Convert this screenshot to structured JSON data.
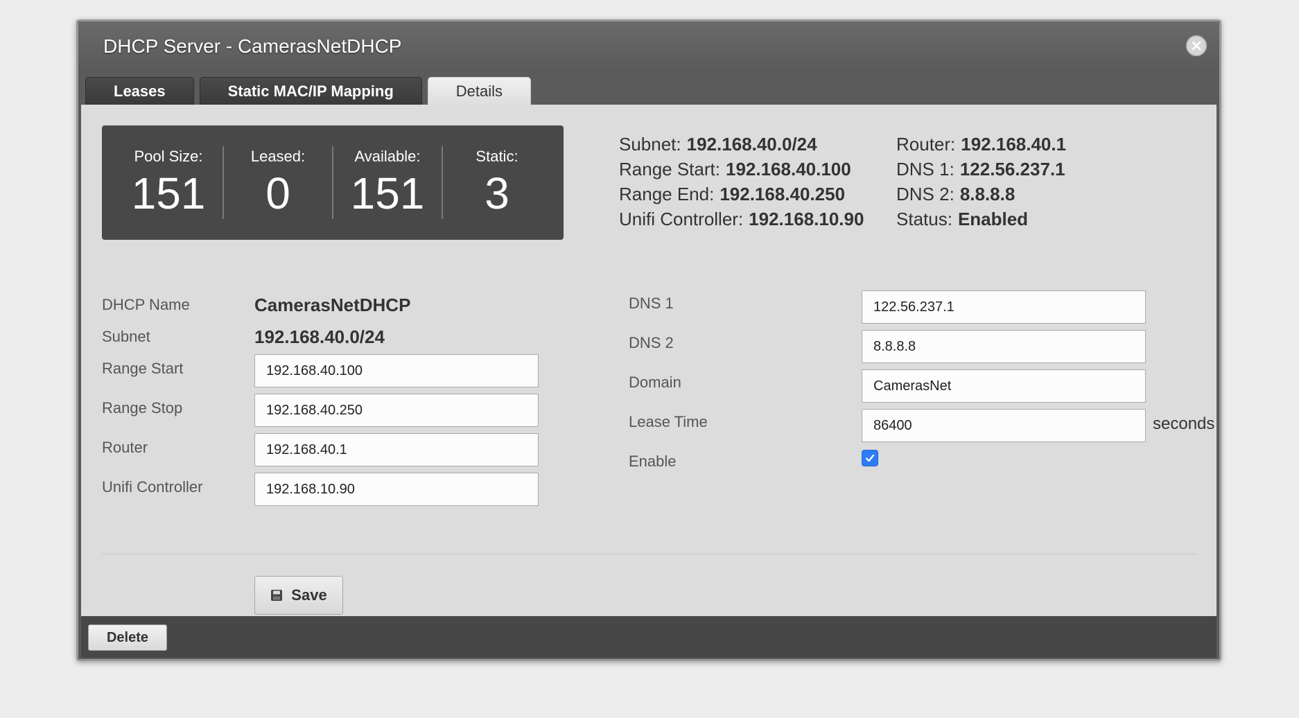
{
  "dialog": {
    "title": "DHCP Server - CamerasNetDHCP",
    "close_icon": "close-circle-icon"
  },
  "tabs": [
    {
      "label": "Leases",
      "active": false
    },
    {
      "label": "Static MAC/IP Mapping",
      "active": false
    },
    {
      "label": "Details",
      "active": true
    }
  ],
  "stats": [
    {
      "label": "Pool Size:",
      "value": "151"
    },
    {
      "label": "Leased:",
      "value": "0"
    },
    {
      "label": "Available:",
      "value": "151"
    },
    {
      "label": "Static:",
      "value": "3"
    }
  ],
  "summary": {
    "left": [
      {
        "label": "Subnet:",
        "value": "192.168.40.0/24"
      },
      {
        "label": "Range Start:",
        "value": "192.168.40.100"
      },
      {
        "label": "Range End:",
        "value": "192.168.40.250"
      },
      {
        "label": "Unifi Controller:",
        "value": "192.168.10.90"
      }
    ],
    "right": [
      {
        "label": "Router:",
        "value": "192.168.40.1"
      },
      {
        "label": "DNS 1:",
        "value": "122.56.237.1"
      },
      {
        "label": "DNS 2:",
        "value": "8.8.8.8"
      },
      {
        "label": "Status:",
        "value": "Enabled"
      }
    ]
  },
  "form": {
    "dhcp_name": {
      "label": "DHCP Name",
      "value": "CamerasNetDHCP"
    },
    "subnet": {
      "label": "Subnet",
      "value": "192.168.40.0/24"
    },
    "range_start": {
      "label": "Range Start",
      "value": "192.168.40.100"
    },
    "range_stop": {
      "label": "Range Stop",
      "value": "192.168.40.250"
    },
    "router": {
      "label": "Router",
      "value": "192.168.40.1"
    },
    "unifi_controller": {
      "label": "Unifi Controller",
      "value": "192.168.10.90"
    },
    "dns1": {
      "label": "DNS 1",
      "value": "122.56.237.1"
    },
    "dns2": {
      "label": "DNS 2",
      "value": "8.8.8.8"
    },
    "domain": {
      "label": "Domain",
      "value": "CamerasNet"
    },
    "lease_time": {
      "label": "Lease Time",
      "value": "86400",
      "suffix": "seconds"
    },
    "enable": {
      "label": "Enable",
      "checked": true
    }
  },
  "buttons": {
    "save": "Save",
    "delete": "Delete"
  },
  "colors": {
    "checkbox_accent": "#2f7df6",
    "stats_panel": "#484848",
    "content_bg": "#dcdcdc"
  }
}
